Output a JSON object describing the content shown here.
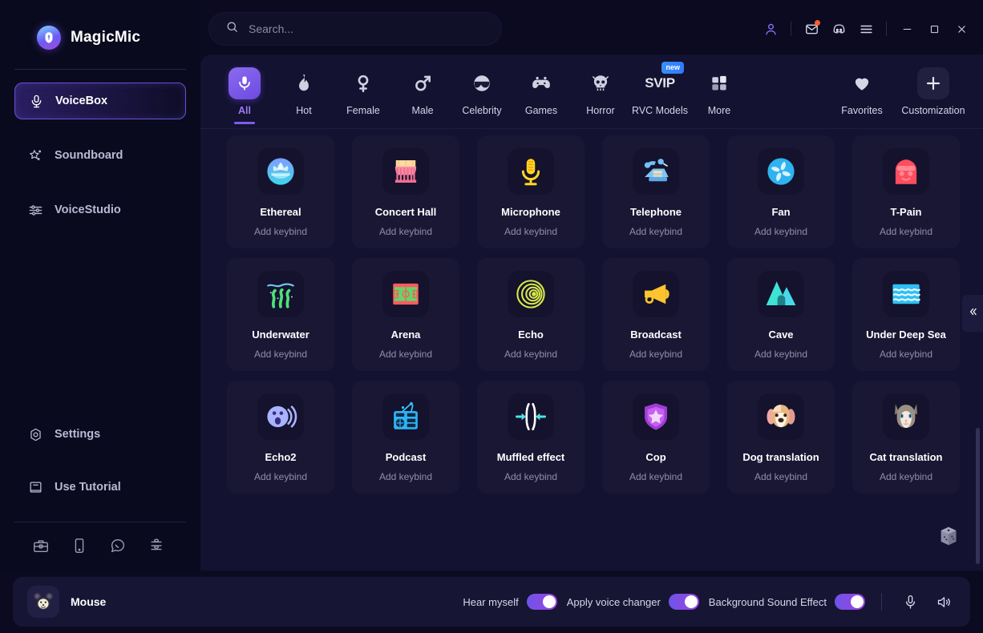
{
  "app": {
    "title": "MagicMic",
    "logo_icon": "magicmic-logo-icon"
  },
  "search": {
    "placeholder": "Search...",
    "value": "",
    "icon": "search-icon"
  },
  "titlebar": {
    "buttons": [
      {
        "name": "account-icon",
        "label": "Account"
      },
      {
        "name": "mail-icon",
        "label": "Mail"
      },
      {
        "name": "discord-icon",
        "label": "Discord"
      },
      {
        "name": "menu-icon",
        "label": "Menu"
      }
    ],
    "window_controls": [
      {
        "name": "minimize-button",
        "label": "Minimize"
      },
      {
        "name": "maximize-button",
        "label": "Maximize"
      },
      {
        "name": "close-button",
        "label": "Close"
      }
    ]
  },
  "sidebar": {
    "items": [
      {
        "label": "VoiceBox",
        "icon": "microphone-icon",
        "active": true
      },
      {
        "label": "Soundboard",
        "icon": "sparkle-icon",
        "active": false
      },
      {
        "label": "VoiceStudio",
        "icon": "sliders-icon",
        "active": false
      }
    ],
    "bottom_items": [
      {
        "label": "Settings",
        "icon": "gear-icon"
      },
      {
        "label": "Use Tutorial",
        "icon": "book-icon"
      }
    ],
    "social_icons": [
      {
        "name": "toolbox-icon"
      },
      {
        "name": "mobile-icon"
      },
      {
        "name": "whatsapp-icon"
      },
      {
        "name": "share-icon"
      }
    ]
  },
  "categories": [
    {
      "label": "All",
      "icon": "mic-badge-icon",
      "active": true,
      "badge": ""
    },
    {
      "label": "Hot",
      "icon": "flame-icon",
      "active": false,
      "badge": ""
    },
    {
      "label": "Female",
      "icon": "female-icon",
      "active": false,
      "badge": ""
    },
    {
      "label": "Male",
      "icon": "male-icon",
      "active": false,
      "badge": ""
    },
    {
      "label": "Celebrity",
      "icon": "sunglasses-icon",
      "active": false,
      "badge": ""
    },
    {
      "label": "Games",
      "icon": "gamepad-icon",
      "active": false,
      "badge": ""
    },
    {
      "label": "Horror",
      "icon": "skull-icon",
      "active": false,
      "badge": ""
    },
    {
      "label": "RVC Models",
      "icon": "svip-icon",
      "active": false,
      "badge": "new"
    },
    {
      "label": "More",
      "icon": "grid-icon",
      "active": false,
      "badge": ""
    }
  ],
  "category_actions": [
    {
      "label": "Favorites",
      "icon": "heart-icon"
    },
    {
      "label": "Customization",
      "icon": "plus-icon"
    }
  ],
  "voices": [
    {
      "title": "Ethereal",
      "keybind": "Add keybind",
      "icon": "lotus-icon"
    },
    {
      "title": "Concert Hall",
      "keybind": "Add keybind",
      "icon": "concert-hall-icon"
    },
    {
      "title": "Microphone",
      "keybind": "Add keybind",
      "icon": "gold-microphone-icon"
    },
    {
      "title": "Telephone",
      "keybind": "Add keybind",
      "icon": "telephone-icon"
    },
    {
      "title": "Fan",
      "keybind": "Add keybind",
      "icon": "fan-icon"
    },
    {
      "title": "T-Pain",
      "keybind": "Add keybind",
      "icon": "t-pain-icon"
    },
    {
      "title": "Underwater",
      "keybind": "Add keybind",
      "icon": "seaweed-icon"
    },
    {
      "title": "Arena",
      "keybind": "Add keybind",
      "icon": "stadium-icon"
    },
    {
      "title": "Echo",
      "keybind": "Add keybind",
      "icon": "echo-rings-icon"
    },
    {
      "title": "Broadcast",
      "keybind": "Add keybind",
      "icon": "megaphone-icon"
    },
    {
      "title": "Cave",
      "keybind": "Add keybind",
      "icon": "cave-mountain-icon"
    },
    {
      "title": "Under Deep Sea",
      "keybind": "Add keybind",
      "icon": "deep-sea-waves-icon"
    },
    {
      "title": "Echo2",
      "keybind": "Add keybind",
      "icon": "shouting-face-icon"
    },
    {
      "title": "Podcast",
      "keybind": "Add keybind",
      "icon": "radio-icon"
    },
    {
      "title": "Muffled effect",
      "keybind": "Add keybind",
      "icon": "muffled-arrows-icon"
    },
    {
      "title": "Cop",
      "keybind": "Add keybind",
      "icon": "police-shield-icon"
    },
    {
      "title": "Dog translation",
      "keybind": "Add keybind",
      "icon": "dog-face-icon"
    },
    {
      "title": "Cat translation",
      "keybind": "Add keybind",
      "icon": "cat-face-icon"
    }
  ],
  "panel_controls": {
    "collapse_icon": "chevron-double-left-icon",
    "random_icon": "dice-icon"
  },
  "bottombar": {
    "avatar_icon": "mouse-avatar-icon",
    "avatar_name": "Mouse",
    "toggles": [
      {
        "label": "Hear myself",
        "on": true
      },
      {
        "label": "Apply voice changer",
        "on": true
      },
      {
        "label": "Background Sound Effect",
        "on": true
      }
    ],
    "icons": [
      {
        "name": "microphone-level-icon"
      },
      {
        "name": "speaker-level-icon"
      }
    ]
  },
  "colors": {
    "accent": "#7d5cf0",
    "panel": "#131230",
    "card": "#191734",
    "background": "#0b0a20",
    "badge_new": "#3a8dff"
  }
}
